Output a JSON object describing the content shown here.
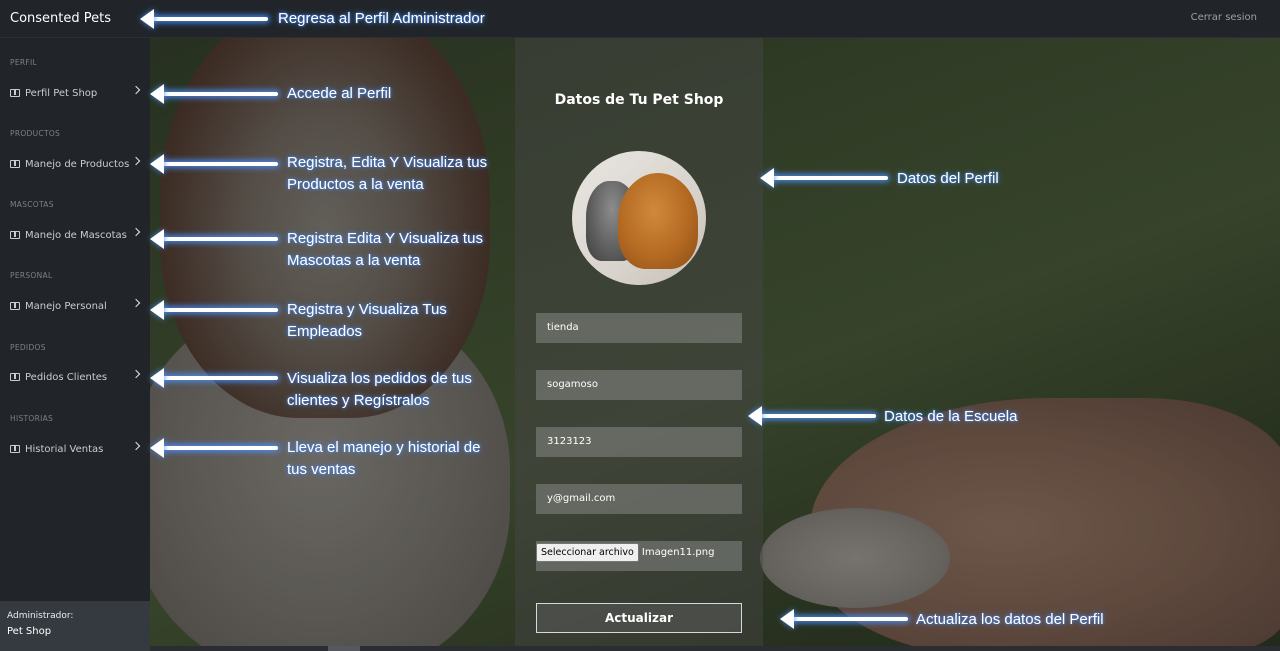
{
  "topbar": {
    "brand": "Consented Pets",
    "logout": "Cerrar sesion"
  },
  "sidebar": {
    "sections": [
      {
        "title": "PERFIL",
        "item": "Perfil Pet Shop"
      },
      {
        "title": "PRODUCTOS",
        "item": "Manejo de Productos"
      },
      {
        "title": "MASCOTAS",
        "item": "Manejo de Mascotas"
      },
      {
        "title": "PERSONAL",
        "item": "Manejo Personal"
      },
      {
        "title": "PEDIDOS",
        "item": "Pedidos Clientes"
      },
      {
        "title": "HISTORIAS",
        "item": "Historial Ventas"
      }
    ],
    "footer": {
      "role": "Administrador:",
      "name": "Pet Shop"
    }
  },
  "form": {
    "title": "Datos de Tu Pet Shop",
    "fields": [
      "tienda",
      "sogamoso",
      "3123123",
      "y@gmail.com"
    ],
    "file_button": "Seleccionar archivo",
    "file_name": "Imagen11.png",
    "submit": "Actualizar"
  },
  "annotations": {
    "home": "Regresa al Perfil Administrador",
    "perfil": "Accede al Perfil",
    "productos_1": "Registra, Edita Y Visualiza tus",
    "productos_2": "Productos a la venta",
    "mascotas_1": "Registra Edita Y Visualiza tus",
    "mascotas_2": "Mascotas a la venta",
    "personal_1": "Registra y Visualiza Tus",
    "personal_2": "Empleados",
    "pedidos_1": "Visualiza los pedidos de tus",
    "pedidos_2": "clientes y Regístralos",
    "historial_1": "Lleva el manejo y historial de",
    "historial_2": "tus ventas",
    "datos_perfil": "Datos del Perfil",
    "datos_escuela": "Datos de la Escuela",
    "actualiza": "Actualiza los datos del Perfil"
  },
  "colors": {
    "annotation_glow": "#4a90ff",
    "topbar": "#212529",
    "sidebar_footer": "#343a40"
  }
}
